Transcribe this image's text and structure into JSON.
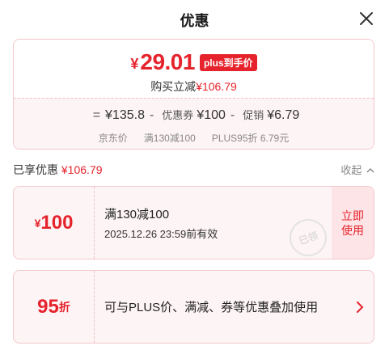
{
  "dialog": {
    "title": "优惠"
  },
  "summary": {
    "yen": "¥",
    "price": "29.01",
    "badge": "plus到手价",
    "save_label": "购买立减",
    "save_amount": "¥106.79",
    "formula": {
      "eq": "=",
      "jd_price": "¥135.8",
      "op1": "-",
      "coupon_label": "优惠券",
      "coupon_amount": "¥100",
      "op2": "-",
      "promo_label": "促销",
      "promo_amount": "¥6.79"
    },
    "labels": {
      "jd_price": "京东价",
      "coupon": "满130减100",
      "promo": "PLUS95折 6.79元"
    }
  },
  "enjoyed": {
    "label": "已享优惠",
    "amount": "¥106.79",
    "collapse": "收起"
  },
  "coupons": [
    {
      "yen": "¥",
      "value": "100",
      "title": "满130减100",
      "validity": "2025.12.26 23:59前有效",
      "action": "立即使用",
      "stamp": "已领"
    },
    {
      "value": "95",
      "unit": "折",
      "title": "可与PLUS价、满减、券等优惠叠加使用"
    }
  ],
  "colors": {
    "accent": "#e6232c",
    "border": "#f3c8cc",
    "panel_bg": "#fdf4f5"
  },
  "icons": {
    "close": "close-icon",
    "collapse": "chevron-up-icon",
    "arrow": "chevron-right-icon"
  }
}
